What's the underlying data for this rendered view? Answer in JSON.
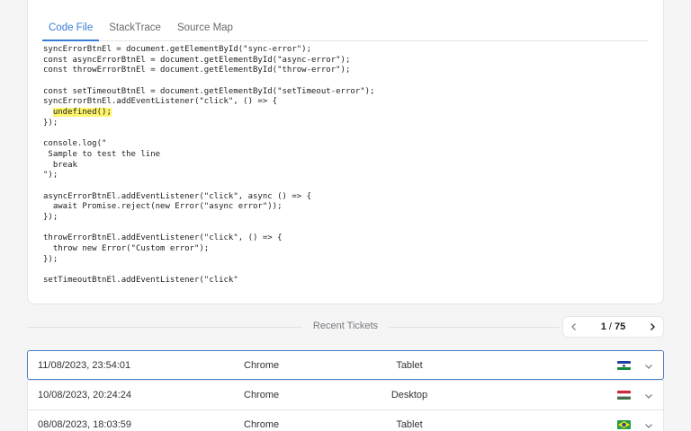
{
  "tabs": [
    {
      "label": "Code File",
      "active": true
    },
    {
      "label": "StackTrace",
      "active": false
    },
    {
      "label": "Source Map",
      "active": false
    }
  ],
  "code_lines": [
    "syncErrorBtnEl = document.getElementById(\"sync-error\");",
    "const asyncErrorBtnEl = document.getElementById(\"async-error\");",
    "const throwErrorBtnEl = document.getElementById(\"throw-error\");",
    "",
    "const setTimeoutBtnEl = document.getElementById(\"setTimeout-error\");",
    "syncErrorBtnEl.addEventListener(\"click\", () => {",
    "  undefined();",
    "});",
    "",
    "console.log(\"",
    " Sample to test the line",
    "  break",
    "\");",
    "",
    "asyncErrorBtnEl.addEventListener(\"click\", async () => {",
    "  await Promise.reject(new Error(\"async error\"));",
    "});",
    "",
    "throwErrorBtnEl.addEventListener(\"click\", () => {",
    "  throw new Error(\"Custom error\");",
    "});",
    "",
    "setTimeoutBtnEl.addEventListener(\"click\""
  ],
  "highlight": {
    "line": 6,
    "prefix": "  ",
    "text": "undefined();"
  },
  "recent_tickets": {
    "title": "Recent Tickets",
    "page_current": "1",
    "page_separator": "/",
    "page_total": "75"
  },
  "tickets": [
    {
      "date": "11/08/2023, 23:54:01",
      "browser": "Chrome",
      "device": "Tablet",
      "flag": "lesotho-flag-icon",
      "active": true
    },
    {
      "date": "10/08/2023, 20:24:24",
      "browser": "Chrome",
      "device": "Desktop",
      "flag": "hungary-flag-icon",
      "active": false
    },
    {
      "date": "08/08/2023, 18:03:59",
      "browser": "Chrome",
      "device": "Tablet",
      "flag": "brazil-flag-icon",
      "active": false
    }
  ],
  "colors": {
    "accent": "#3a7bd5",
    "highlight": "#fdf46b",
    "active_border": "#4a7fc7"
  }
}
